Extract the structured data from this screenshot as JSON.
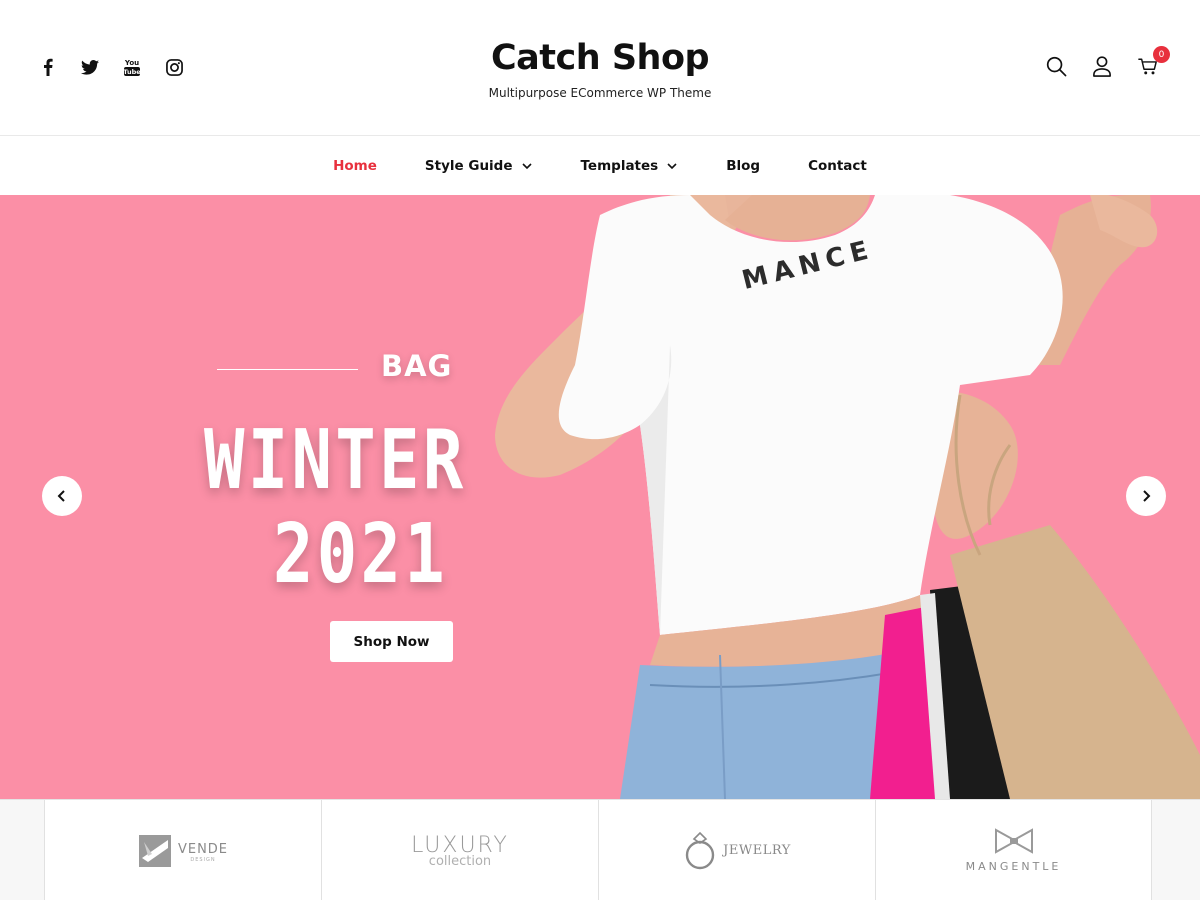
{
  "header": {
    "title": "Catch Shop",
    "tagline": "Multipurpose ECommerce WP Theme",
    "social": [
      "facebook-icon",
      "twitter-icon",
      "youtube-icon",
      "instagram-icon"
    ],
    "youtube_icon_text": [
      "You",
      "Tube"
    ],
    "cart_count": "0"
  },
  "nav": {
    "items": [
      {
        "label": "Home",
        "active": true
      },
      {
        "label": "Style Guide",
        "dropdown": true
      },
      {
        "label": "Templates",
        "dropdown": true
      },
      {
        "label": "Blog"
      },
      {
        "label": "Contact"
      }
    ]
  },
  "hero": {
    "kicker": "BAG",
    "headline": "WINTER",
    "year": "2021",
    "cta": "Shop Now",
    "shirt_text": "MANCE",
    "background": "#fb8fa6"
  },
  "brands": [
    {
      "name": "VENDE",
      "sub": "DESIGN"
    },
    {
      "name": "LUXURY",
      "sub": "collection"
    },
    {
      "name": "JEWELRY"
    },
    {
      "name": "MANGENTLE"
    }
  ],
  "colors": {
    "accent": "#e8303d",
    "hero_pink": "#fb8fa6"
  }
}
